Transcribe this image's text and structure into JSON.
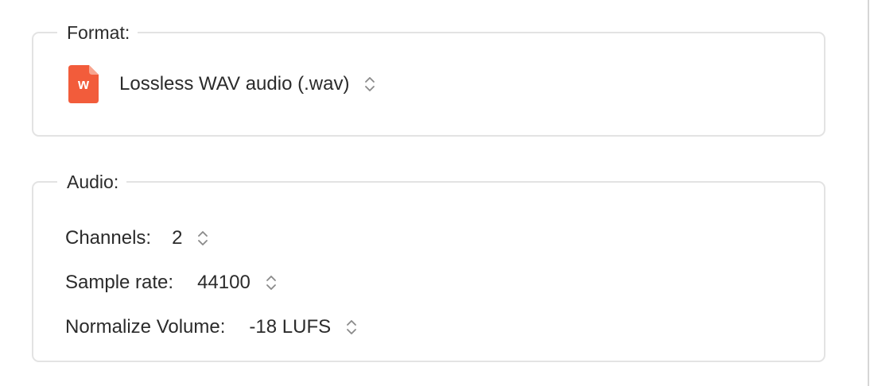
{
  "format_group": {
    "legend": "Format:",
    "file_icon": {
      "name": "wav-file-icon",
      "letter": "w",
      "color": "#f25c3b"
    },
    "format_value": "Lossless WAV audio (.wav)"
  },
  "audio_group": {
    "legend": "Audio:",
    "channels": {
      "label": "Channels:",
      "value": "2"
    },
    "sample_rate": {
      "label": "Sample rate:",
      "value": "44100"
    },
    "normalize_volume": {
      "label": "Normalize Volume:",
      "value": "-18 LUFS"
    }
  },
  "colors": {
    "accent_file_icon": "#f25c3b",
    "group_border": "#e3e3e3",
    "text": "#2b2b2b",
    "chevron": "#8a8a8a"
  }
}
